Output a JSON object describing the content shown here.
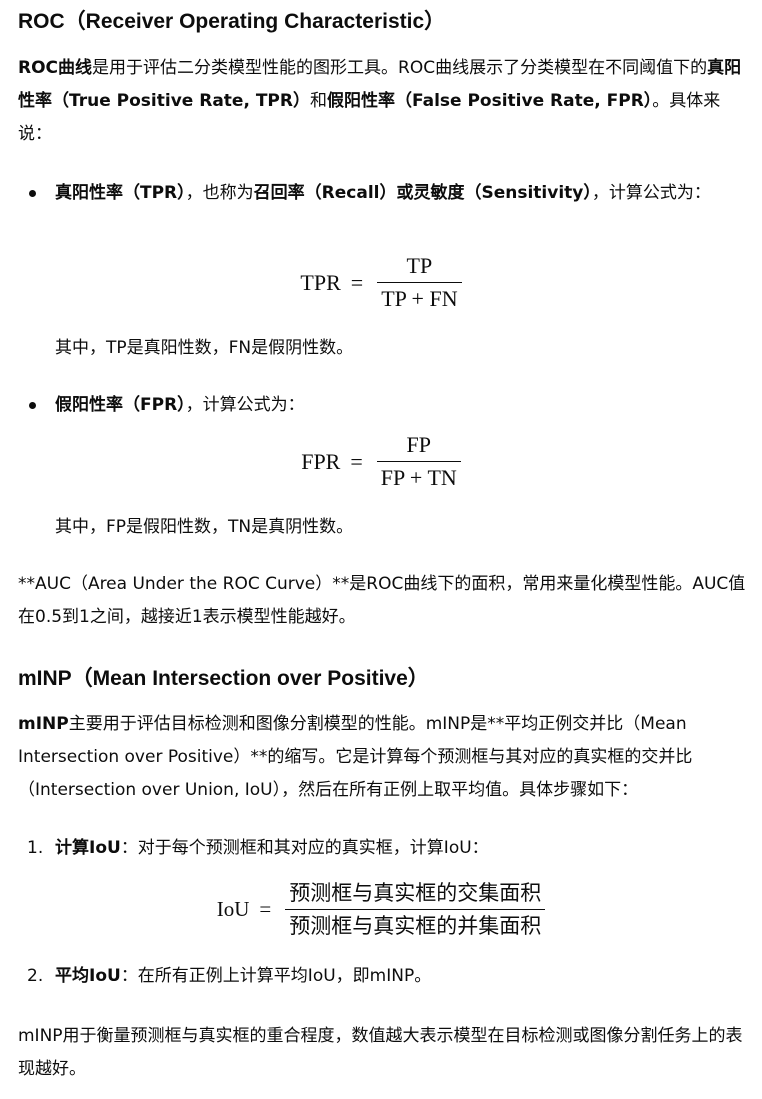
{
  "roc": {
    "title": "ROC（Receiver Operating Characteristic）",
    "intro_b1": "ROC曲线",
    "intro_t1": "是用于评估二分类模型性能的图形工具。ROC曲线展示了分类模型在不同阈值下的",
    "intro_b2": "真阳性率（True Positive Rate, TPR）",
    "intro_t2": "和",
    "intro_b3": "假阳性率（False Positive Rate, FPR）",
    "intro_t3": "。具体来说：",
    "tpr": {
      "b1": "真阳性率（TPR）",
      "t1": "，也称为",
      "b2": "召回率（Recall）或灵敏度（Sensitivity）",
      "t2": "，计算公式为：",
      "lhs": "TPR",
      "eq": "=",
      "num": "TP",
      "den": "TP + FN",
      "note": "其中，TP是真阳性数，FN是假阴性数。"
    },
    "fpr": {
      "b1": "假阳性率（FPR）",
      "t1": "，计算公式为：",
      "lhs": "FPR",
      "eq": "=",
      "num": "FP",
      "den": "FP + TN",
      "note": "其中，FP是假阳性数，TN是真阴性数。"
    },
    "auc": "**AUC（Area Under the ROC Curve）**是ROC曲线下的面积，常用来量化模型性能。AUC值在0.5到1之间，越接近1表示模型性能越好。"
  },
  "minp": {
    "title": "mINP（Mean Intersection over Positive）",
    "intro_b1": "mINP",
    "intro_t1": "主要用于评估目标检测和图像分割模型的性能。mINP是**平均正例交并比（Mean Intersection over Positive）**的缩写。它是计算每个预测框与其对应的真实框的交并比（Intersection over Union, IoU），然后在所有正例上取平均值。具体步骤如下：",
    "steps": [
      {
        "num": "1.",
        "bold": "计算IoU",
        "text": "：对于每个预测框和其对应的真实框，计算IoU："
      },
      {
        "num": "2.",
        "bold": "平均IoU",
        "text": "：在所有正例上计算平均IoU，即mINP。"
      }
    ],
    "iou": {
      "lhs": "IoU",
      "eq": "=",
      "num": "预测框与真实框的交集面积",
      "den": "预测框与真实框的并集面积"
    },
    "outro": "mINP用于衡量预测框与真实框的重合程度，数值越大表示模型在目标检测或图像分割任务上的表现越好。"
  }
}
